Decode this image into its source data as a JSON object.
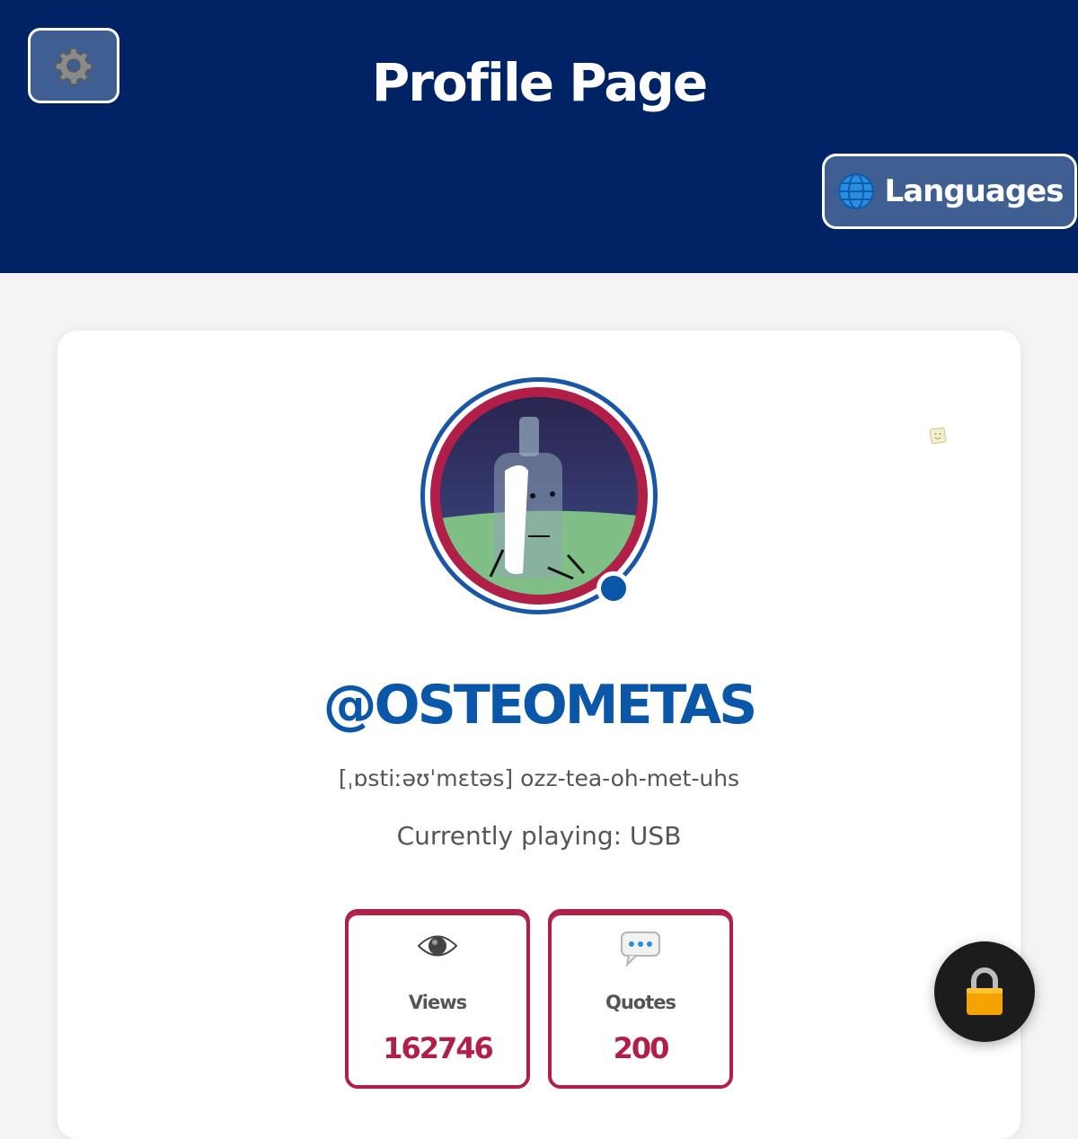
{
  "header": {
    "title": "Profile Page",
    "languages_label": "Languages"
  },
  "icons": {
    "settings": "gear-icon",
    "languages": "globe-icon",
    "views": "eye-icon",
    "quotes": "speech-bubble-icon",
    "lock": "lock-icon"
  },
  "profile": {
    "username": "@OSTEOMETAS",
    "pronunciation": "[ˌɒstiːəʊˈmɛtəs] ozz-tea-oh-met-uhs",
    "currently_playing": "Currently playing: USB",
    "online": true
  },
  "stats": [
    {
      "label": "Views",
      "value": "162746"
    },
    {
      "label": "Quotes",
      "value": "200"
    }
  ],
  "colors": {
    "header_bg": "#002366",
    "accent_blue": "#0a56a8",
    "accent_red": "#b11f49",
    "button_bg": "#3f5f93"
  }
}
